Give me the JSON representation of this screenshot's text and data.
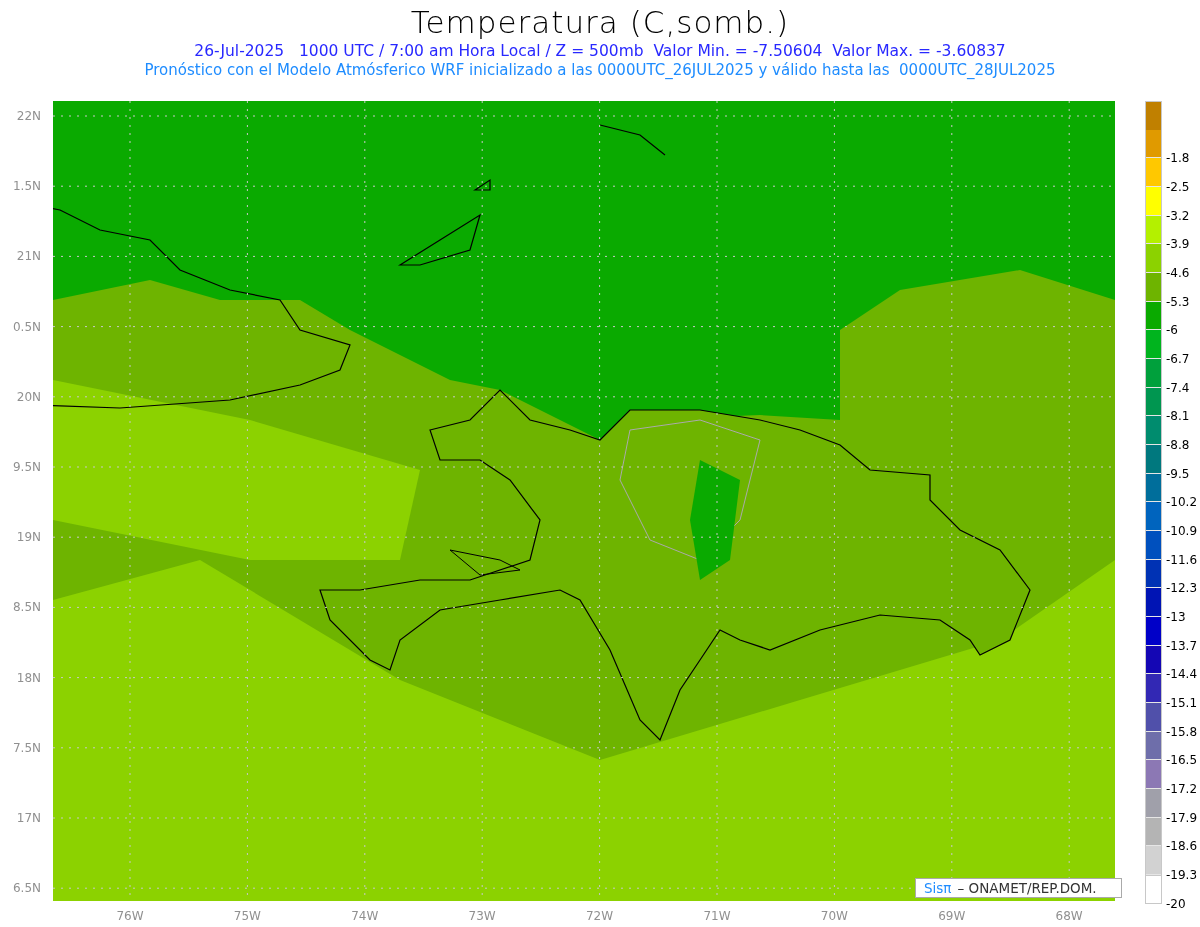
{
  "header": {
    "title": "Temperatura (C,somb.)",
    "line_1": "26-Jul-2025   1000 UTC / 7:00 am Hora Local / Z = 500mb  Valor Min. = -7.50604  Valor Max. = -3.60837",
    "line_2": "Pronóstico con el Modelo Atmósferico WRF inicializado a las 0000UTC_26JUL2025 y válido hasta las  0000UTC_28JUL2025"
  },
  "map": {
    "lat_labels": [
      "22N",
      "1.5N",
      "21N",
      "0.5N",
      "20N",
      "9.5N",
      "19N",
      "8.5N",
      "18N",
      "7.5N",
      "17N",
      "6.5N"
    ],
    "lon_labels": [
      "76W",
      "75W",
      "74W",
      "73W",
      "72W",
      "71W",
      "70W",
      "69W",
      "68W"
    ],
    "credit": {
      "brand": "Sisπ",
      "text": "– ONAMET/REP.DOM."
    }
  },
  "colorbar": [
    {
      "color": "#c08000"
    },
    {
      "color": "#e09a00",
      "label": "-1.8"
    },
    {
      "color": "#ffc800",
      "label": "-2.5"
    },
    {
      "color": "#ffff00",
      "label": "-3.2"
    },
    {
      "color": "#b4f000",
      "label": "-3.9"
    },
    {
      "color": "#8cd200",
      "label": "-4.6"
    },
    {
      "color": "#6eb400",
      "label": "-5.3"
    },
    {
      "color": "#0aaa00",
      "label": "-6"
    },
    {
      "color": "#00b41e",
      "label": "-6.7"
    },
    {
      "color": "#00a03c",
      "label": "-7.4"
    },
    {
      "color": "#009650",
      "label": "-8.1"
    },
    {
      "color": "#008c6e",
      "label": "-8.8"
    },
    {
      "color": "#00787e",
      "label": "-9.5"
    },
    {
      "color": "#006e9b",
      "label": "-10.2"
    },
    {
      "color": "#0064be",
      "label": "-10.9"
    },
    {
      "color": "#0050be",
      "label": "-11.6"
    },
    {
      "color": "#0032b4",
      "label": "-12.3"
    },
    {
      "color": "#0014b4",
      "label": "-13"
    },
    {
      "color": "#0000c8",
      "label": "-13.7"
    },
    {
      "color": "#1406b4",
      "label": "-14.4"
    },
    {
      "color": "#3228b4",
      "label": "-15.1"
    },
    {
      "color": "#5050aa",
      "label": "-15.8"
    },
    {
      "color": "#6e6eaa",
      "label": "-16.5"
    },
    {
      "color": "#8c78b4",
      "label": "-17.2"
    },
    {
      "color": "#a0a0aa",
      "label": "-17.9"
    },
    {
      "color": "#b4b4b4",
      "label": "-18.6"
    },
    {
      "color": "#d2d2d2",
      "label": "-19.3"
    },
    {
      "color": "#ffffff",
      "label": "-20"
    }
  ]
}
